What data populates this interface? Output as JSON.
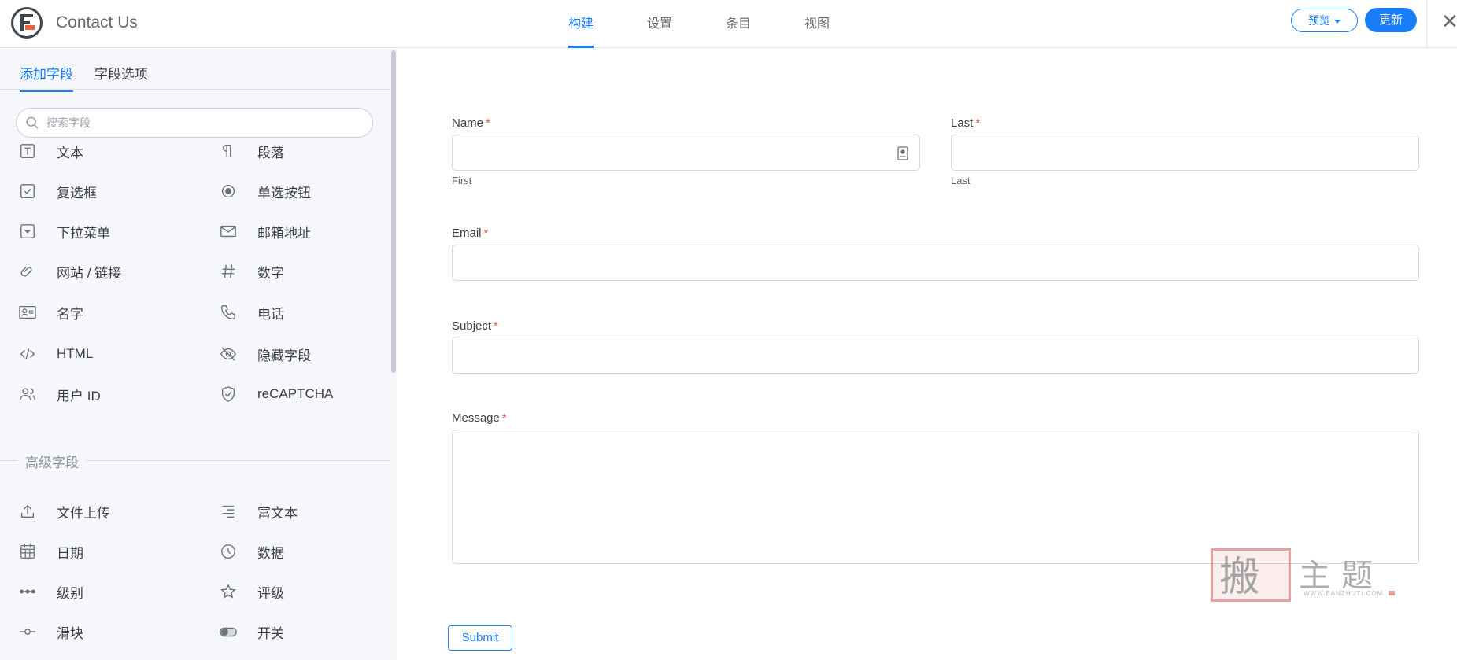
{
  "app": {
    "title": "Contact Us"
  },
  "nav": {
    "tabs": [
      "构建",
      "设置",
      "条目",
      "视图"
    ],
    "active": 0
  },
  "actions": {
    "preview_label": "预览",
    "update_label": "更新"
  },
  "sidebar": {
    "tabs": [
      "添加字段",
      "字段选项"
    ],
    "active_tab": 0,
    "search_placeholder": "搜索字段",
    "basic_fields": [
      {
        "label": "文本",
        "icon": "text-icon"
      },
      {
        "label": "段落",
        "icon": "paragraph-icon"
      },
      {
        "label": "复选框",
        "icon": "checkbox-icon"
      },
      {
        "label": "单选按钮",
        "icon": "radio-icon"
      },
      {
        "label": "下拉菜单",
        "icon": "dropdown-icon"
      },
      {
        "label": "邮箱地址",
        "icon": "mail-icon"
      },
      {
        "label": "网站 / 链接",
        "icon": "link-icon"
      },
      {
        "label": "数字",
        "icon": "hash-icon"
      },
      {
        "label": "名字",
        "icon": "id-card-icon"
      },
      {
        "label": "电话",
        "icon": "phone-icon"
      },
      {
        "label": "HTML",
        "icon": "code-icon"
      },
      {
        "label": "隐藏字段",
        "icon": "eye-off-icon"
      },
      {
        "label": "用户 ID",
        "icon": "users-icon"
      },
      {
        "label": "reCAPTCHA",
        "icon": "shield-check-icon"
      }
    ],
    "advanced_title": "高级字段",
    "advanced_fields": [
      {
        "label": "文件上传",
        "icon": "upload-icon"
      },
      {
        "label": "富文本",
        "icon": "align-right-icon"
      },
      {
        "label": "日期",
        "icon": "calendar-icon"
      },
      {
        "label": "数据",
        "icon": "clock-icon"
      },
      {
        "label": "级别",
        "icon": "level-dots-icon"
      },
      {
        "label": "评级",
        "icon": "star-icon"
      },
      {
        "label": "滑块",
        "icon": "slider-icon"
      },
      {
        "label": "开关",
        "icon": "toggle-icon"
      }
    ]
  },
  "form": {
    "name_label": "Name",
    "name_first_sub": "First",
    "last_label": "Last",
    "last_sub": "Last",
    "email_label": "Email",
    "subject_label": "Subject",
    "message_label": "Message",
    "required_mark": "*",
    "submit_label": "Submit"
  },
  "watermark": {
    "seal": "搬",
    "text": "主题",
    "url": "WWW.BANZHUTI.COM"
  },
  "colors": {
    "accent": "#1a7efb",
    "required": "#e8563d",
    "sidebar_bg": "#f6f7fa"
  }
}
